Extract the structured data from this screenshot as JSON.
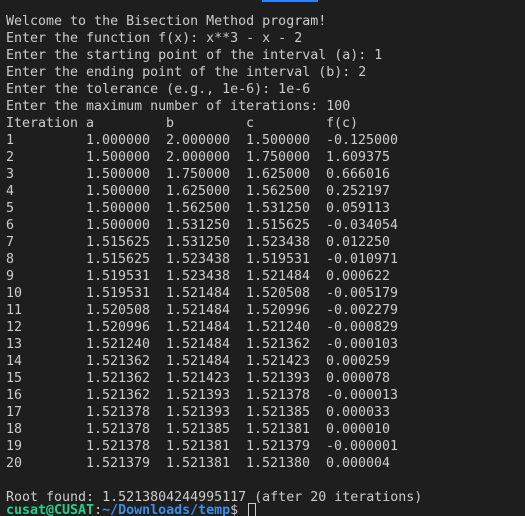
{
  "intro": [
    "Welcome to the Bisection Method program!",
    "Enter the function f(x): x**3 - x - 2",
    "Enter the starting point of the interval (a): 1",
    "Enter the ending point of the interval (b): 2",
    "Enter the tolerance (e.g., 1e-6): 1e-6",
    "Enter the maximum number of iterations: 100"
  ],
  "table": {
    "headers": [
      "Iteration",
      "a",
      "b",
      "c",
      "f(c)"
    ],
    "rows": [
      [
        "1",
        "1.000000",
        "2.000000",
        "1.500000",
        "-0.125000"
      ],
      [
        "2",
        "1.500000",
        "2.000000",
        "1.750000",
        "1.609375"
      ],
      [
        "3",
        "1.500000",
        "1.750000",
        "1.625000",
        "0.666016"
      ],
      [
        "4",
        "1.500000",
        "1.625000",
        "1.562500",
        "0.252197"
      ],
      [
        "5",
        "1.500000",
        "1.562500",
        "1.531250",
        "0.059113"
      ],
      [
        "6",
        "1.500000",
        "1.531250",
        "1.515625",
        "-0.034054"
      ],
      [
        "7",
        "1.515625",
        "1.531250",
        "1.523438",
        "0.012250"
      ],
      [
        "8",
        "1.515625",
        "1.523438",
        "1.519531",
        "-0.010971"
      ],
      [
        "9",
        "1.519531",
        "1.523438",
        "1.521484",
        "0.000622"
      ],
      [
        "10",
        "1.519531",
        "1.521484",
        "1.520508",
        "-0.005179"
      ],
      [
        "11",
        "1.520508",
        "1.521484",
        "1.520996",
        "-0.002279"
      ],
      [
        "12",
        "1.520996",
        "1.521484",
        "1.521240",
        "-0.000829"
      ],
      [
        "13",
        "1.521240",
        "1.521484",
        "1.521362",
        "-0.000103"
      ],
      [
        "14",
        "1.521362",
        "1.521484",
        "1.521423",
        "0.000259"
      ],
      [
        "15",
        "1.521362",
        "1.521423",
        "1.521393",
        "0.000078"
      ],
      [
        "16",
        "1.521362",
        "1.521393",
        "1.521378",
        "-0.000013"
      ],
      [
        "17",
        "1.521378",
        "1.521393",
        "1.521385",
        "0.000033"
      ],
      [
        "18",
        "1.521378",
        "1.521385",
        "1.521381",
        "0.000010"
      ],
      [
        "19",
        "1.521378",
        "1.521381",
        "1.521379",
        "-0.000001"
      ],
      [
        "20",
        "1.521379",
        "1.521381",
        "1.521380",
        "0.000004"
      ]
    ]
  },
  "result": "Root found: 1.5213804244995117 (after 20 iterations)",
  "prompt": {
    "user": "cusat@CUSAT",
    "colon": ":",
    "path": "~/Downloads/temp",
    "dollar": "$ "
  },
  "colors": {
    "background": "#1e1e1e",
    "text": "#cccccc",
    "prompt_user": "#23d18b",
    "prompt_path": "#3b8eea",
    "tab_indicator": "#2f81f7"
  }
}
